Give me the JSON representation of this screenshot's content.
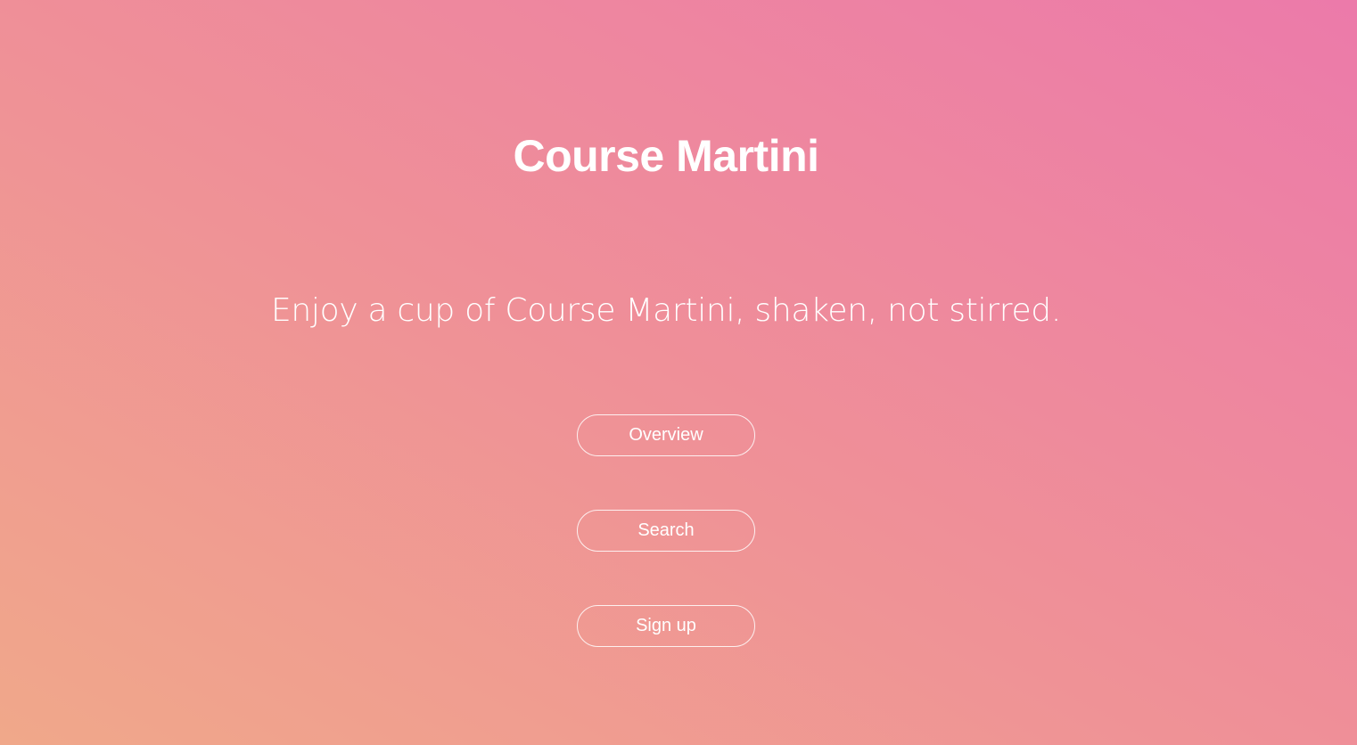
{
  "hero": {
    "title": "Course Martini",
    "tagline": "Enjoy a cup of Course Martini, shaken, not stirred."
  },
  "actions": {
    "overview_label": "Overview",
    "search_label": "Search",
    "signup_label": "Sign up"
  },
  "colors": {
    "gradient_bottom_left": "#f0a88a",
    "gradient_middle": "#ef8f98",
    "gradient_top_right": "#ec7aaa",
    "text": "#ffffff"
  }
}
